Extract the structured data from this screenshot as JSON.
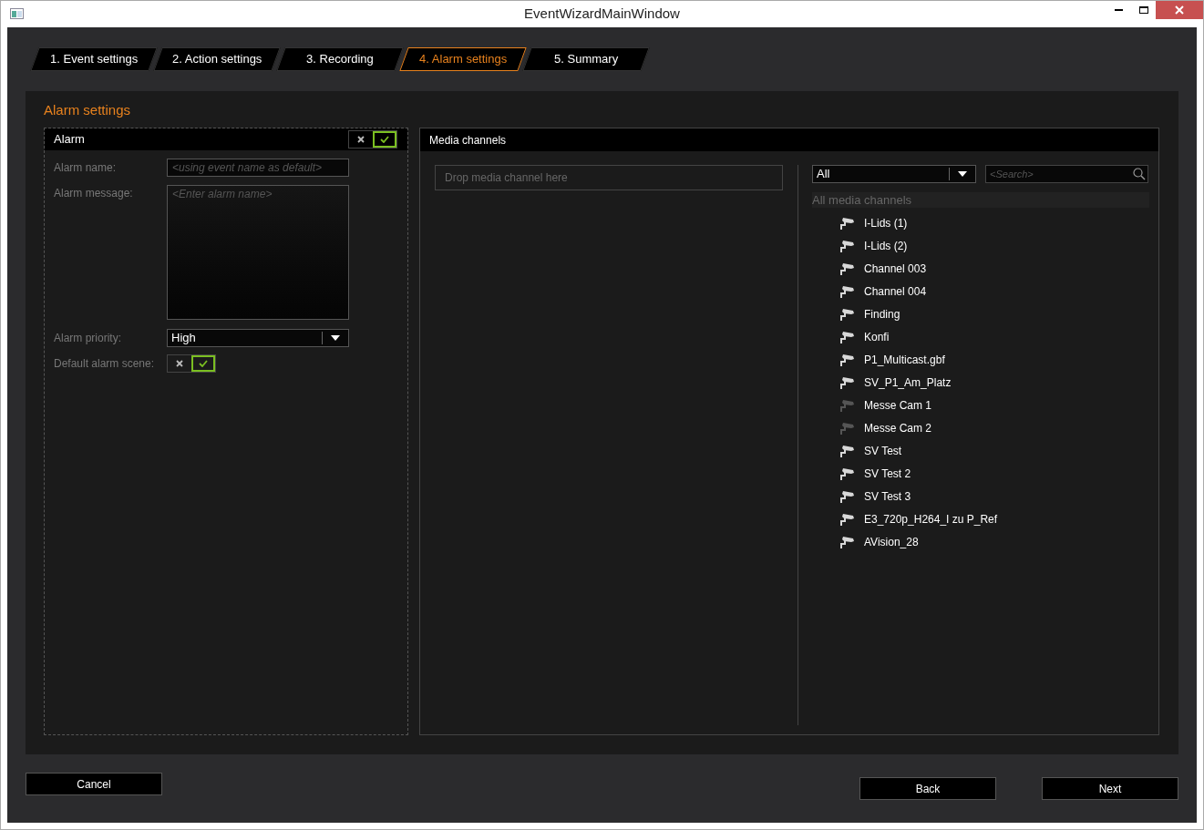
{
  "window": {
    "title": "EventWizardMainWindow"
  },
  "tabs": [
    {
      "label": "1. Event settings",
      "selected": false
    },
    {
      "label": "2. Action settings",
      "selected": false
    },
    {
      "label": "3. Recording",
      "selected": false
    },
    {
      "label": "4. Alarm settings",
      "selected": true
    },
    {
      "label": "5. Summary",
      "selected": false
    }
  ],
  "section_title": "Alarm settings",
  "alarm_panel": {
    "title": "Alarm",
    "enabled": true,
    "alarm_name": {
      "label": "Alarm name:",
      "placeholder": "<using event name as default>"
    },
    "alarm_message": {
      "label": "Alarm message:",
      "placeholder": "<Enter alarm name>"
    },
    "alarm_priority": {
      "label": "Alarm priority:",
      "value": "High"
    },
    "default_alarm_scene": {
      "label": "Default alarm scene:",
      "on": true
    }
  },
  "media_panel": {
    "title": "Media channels",
    "drop_placeholder": "Drop media channel here",
    "filter": "All",
    "search_placeholder": "<Search>",
    "list_header": "All media channels",
    "channels": [
      {
        "name": "I-Lids (1)",
        "online": true
      },
      {
        "name": "I-Lids (2)",
        "online": true
      },
      {
        "name": "Channel 003",
        "online": true
      },
      {
        "name": "Channel 004",
        "online": true
      },
      {
        "name": "Finding",
        "online": true
      },
      {
        "name": "Konfi",
        "online": true
      },
      {
        "name": "P1_Multicast.gbf",
        "online": true
      },
      {
        "name": "SV_P1_Am_Platz",
        "online": true
      },
      {
        "name": "Messe Cam 1",
        "online": false
      },
      {
        "name": "Messe Cam 2",
        "online": false
      },
      {
        "name": "SV Test",
        "online": true
      },
      {
        "name": "SV Test 2",
        "online": true
      },
      {
        "name": "SV Test 3",
        "online": true
      },
      {
        "name": "E3_720p_H264_I zu P_Ref",
        "online": true
      },
      {
        "name": "AVision_28",
        "online": true
      }
    ]
  },
  "buttons": {
    "cancel": "Cancel",
    "back": "Back",
    "next": "Next"
  }
}
